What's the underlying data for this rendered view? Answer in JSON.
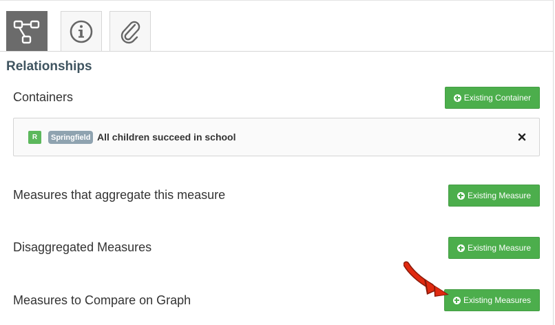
{
  "tabs": [
    {
      "icon": "relationships-icon",
      "active": true
    },
    {
      "icon": "info-icon",
      "active": false
    },
    {
      "icon": "paperclip-icon",
      "active": false
    }
  ],
  "section": {
    "title": "Relationships"
  },
  "containers": {
    "label": "Containers",
    "button_label": "Existing Container",
    "items": [
      {
        "badge": "R",
        "tag": "Springfield",
        "text": "All children succeed in school"
      }
    ]
  },
  "aggregate": {
    "label": "Measures that aggregate this measure",
    "button_label": "Existing Measure"
  },
  "disaggregated": {
    "label": "Disaggregated Measures",
    "button_label": "Existing Measure"
  },
  "compare": {
    "label": "Measures to Compare on Graph",
    "button_label": "Existing Measures"
  },
  "colors": {
    "button_green": "#4cae4c",
    "active_tab": "#6b6b6b",
    "section_title": "#3f5460",
    "tag": "#8fa3b0",
    "annotation_arrow": "#e02a10"
  }
}
